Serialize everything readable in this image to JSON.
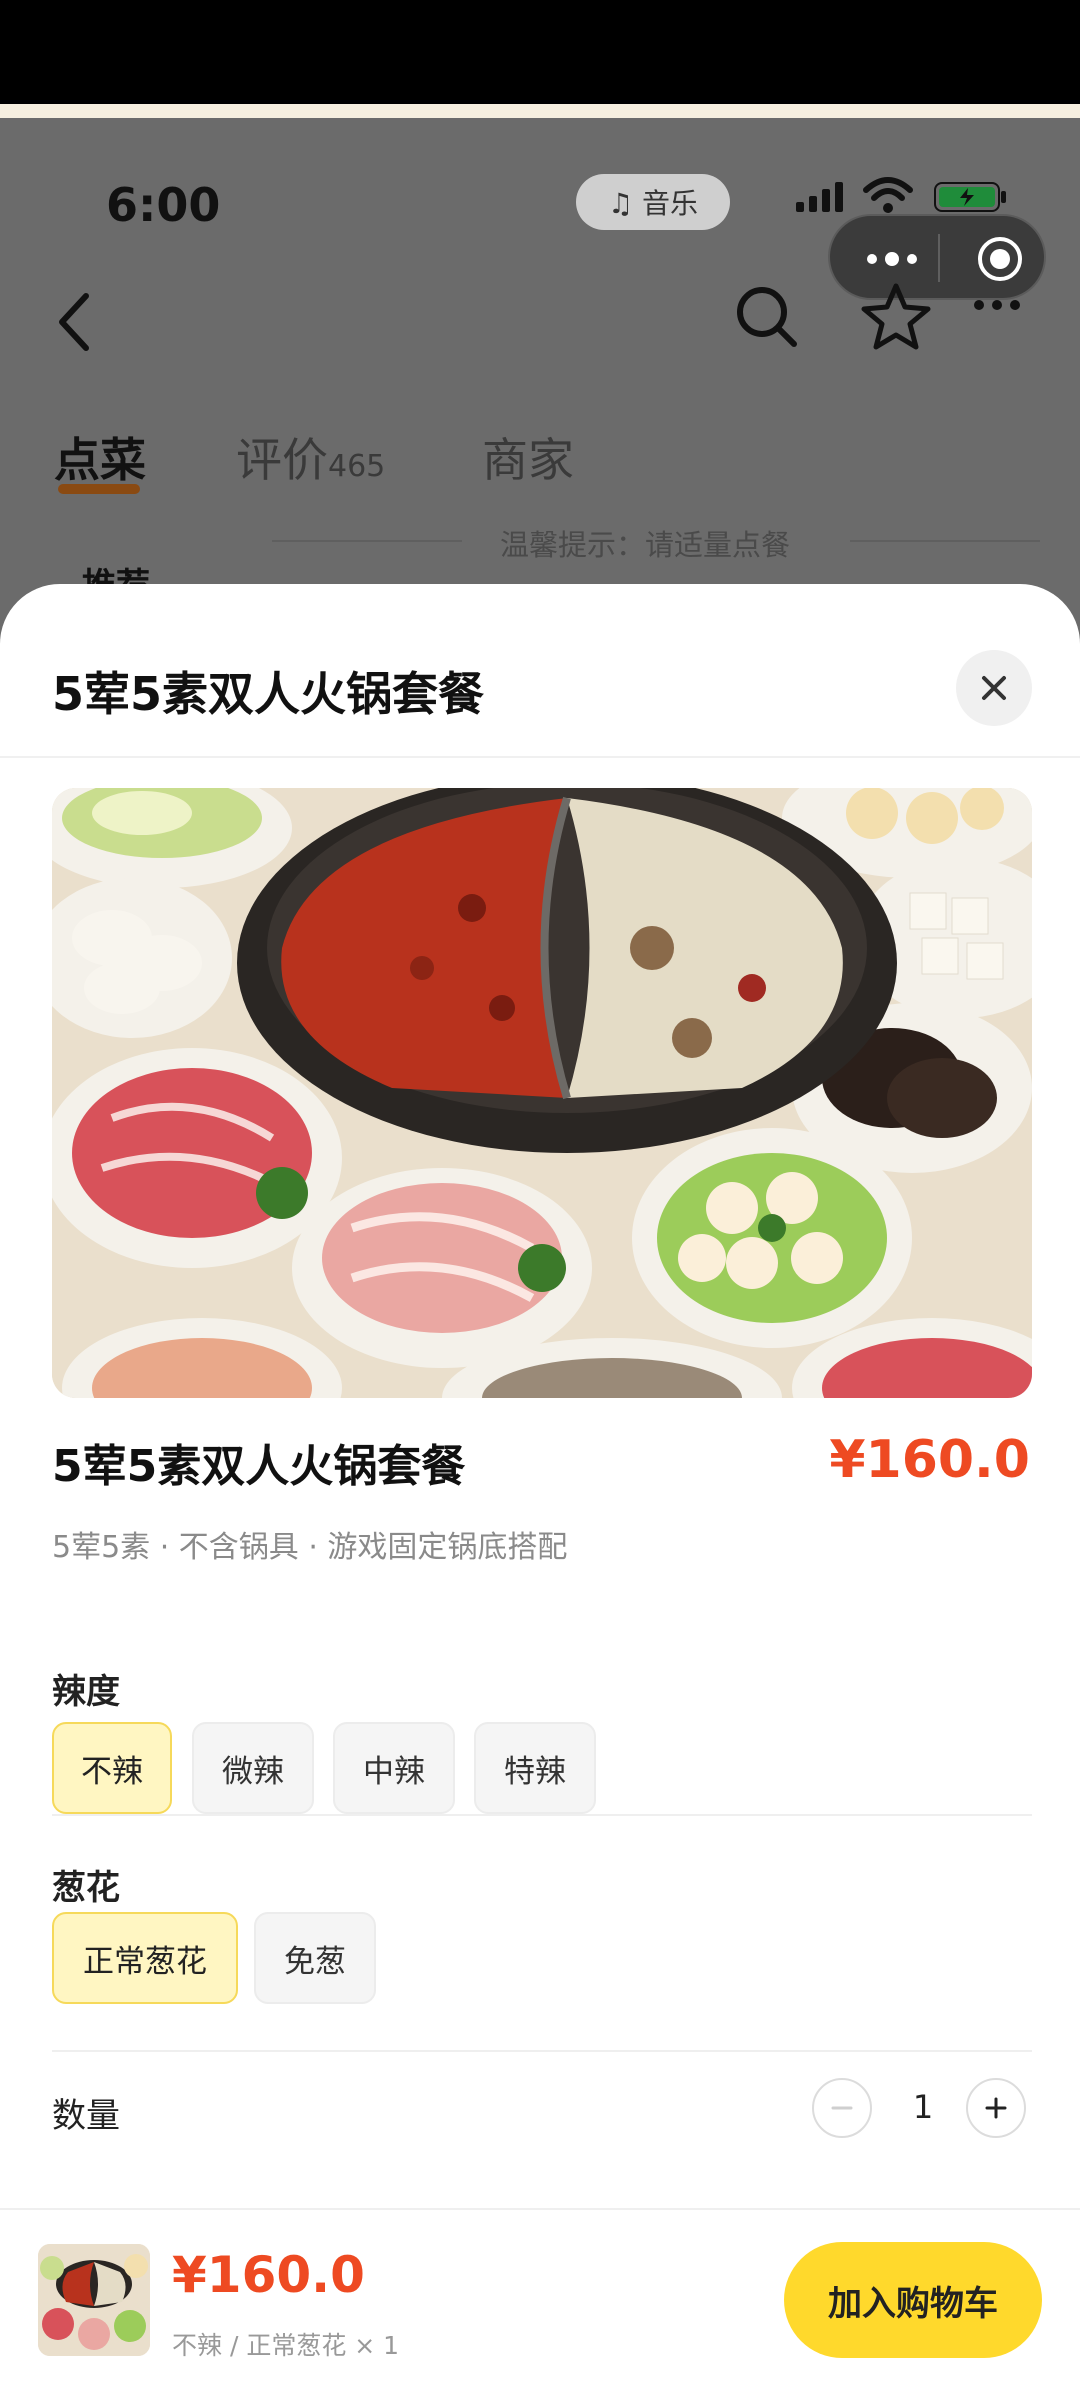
{
  "status_bar": {
    "time": "6:00",
    "music_label": "♫ 音乐"
  },
  "tabs": [
    {
      "label": "点菜"
    },
    {
      "label": "评价",
      "count": "465"
    },
    {
      "label": "商家"
    }
  ],
  "tip": "温馨提示：请适量点餐",
  "sidebar_first": "推荐",
  "sheet": {
    "title": "5荤5素双人火锅套餐",
    "dish_name": "5荤5素双人火锅套餐",
    "price": "¥160.0",
    "description": "5荤5素 · 不含锅具 · 游戏固定锅底搭配",
    "spice": {
      "label": "辣度",
      "options": [
        "不辣",
        "微辣",
        "中辣",
        "特辣"
      ],
      "selected": "不辣"
    },
    "scallion": {
      "label": "葱花",
      "options": [
        "正常葱花",
        "免葱"
      ],
      "selected": "正常葱花"
    },
    "quantity": {
      "label": "数量",
      "value": "1"
    }
  },
  "footer": {
    "total": "¥160.0",
    "selection_summary": "不辣 / 正常葱花 × 1",
    "add_to_cart": "加入购物车"
  },
  "colors": {
    "accent_price": "#ee4a22",
    "cart_button": "#ffd92c",
    "selected_option_bg": "#fff6c2"
  },
  "icons": [
    "back-arrow-icon",
    "search-icon",
    "star-icon",
    "more-dots-icon",
    "close-icon",
    "minus-icon",
    "plus-icon",
    "music-note-icon",
    "record-target-icon"
  ]
}
